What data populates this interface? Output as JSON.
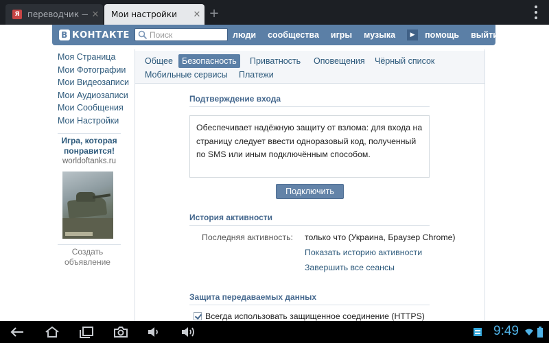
{
  "browser": {
    "tabs": [
      {
        "label": "переводчик — Ян",
        "favicon": "yandex-favicon"
      },
      {
        "label": "Мои настройки"
      }
    ],
    "newtab_label": "+",
    "close_label": "✕"
  },
  "header": {
    "logo_letter": "В",
    "logo_text": "КОНТАКТЕ",
    "search_placeholder": "Поиск",
    "nav": [
      "люди",
      "сообщества",
      "игры",
      "музыка",
      "помощь",
      "выйти"
    ],
    "more_label": "▶"
  },
  "sidebar": {
    "items": [
      "Моя Страница",
      "Мои Фотографии",
      "Мои Видеозаписи",
      "Мои Аудиозаписи",
      "Мои Сообщения",
      "Мои Настройки"
    ],
    "ad": {
      "title": "Игра, которая понравится!",
      "domain": "worldoftanks.ru"
    },
    "create_ad": "Создать объявление"
  },
  "settings_tabs": [
    {
      "label": "Общее",
      "active": false
    },
    {
      "label": "Безопасность",
      "active": true
    },
    {
      "label": "Приватность",
      "active": false
    },
    {
      "label": "Оповещения",
      "active": false
    },
    {
      "label": "Чёрный список",
      "active": false
    },
    {
      "label": "Мобильные сервисы",
      "active": false
    },
    {
      "label": "Платежи",
      "active": false
    }
  ],
  "login_confirm": {
    "title": "Подтверждение входа",
    "description": "Обеспечивает надёжную защиту от взлома: для входа на страницу следует ввести одноразовый код, полученный по SMS или иным подключённым способом.",
    "button": "Подключить"
  },
  "activity": {
    "title": "История активности",
    "last_label": "Последняя активность:",
    "last_value": "только что (Украина, Браузер Chrome)",
    "show_history": "Показать историю активности",
    "end_sessions": "Завершить все сеансы"
  },
  "data_protection": {
    "title": "Защита передаваемых данных",
    "https_label": "Всегда использовать защищенное соединение (HTTPS)",
    "https_checked": true
  },
  "system_bar": {
    "time": "9:49"
  },
  "colors": {
    "vk_blue": "#5b7fa6",
    "link": "#2b587a",
    "clock": "#4fb2e6"
  }
}
